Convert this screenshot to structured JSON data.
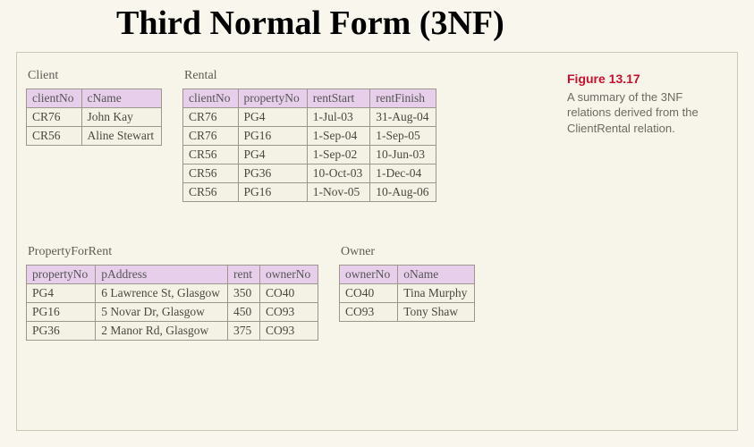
{
  "title": "Third Normal Form (3NF)",
  "caption": {
    "figure_label": "Figure 13.17",
    "text": "A summary of the 3NF relations derived from the ClientRental relation."
  },
  "tables": {
    "client": {
      "label": "Client",
      "columns": [
        "clientNo",
        "cName"
      ],
      "rows": [
        [
          "CR76",
          "John Kay"
        ],
        [
          "CR56",
          "Aline Stewart"
        ]
      ]
    },
    "rental": {
      "label": "Rental",
      "columns": [
        "clientNo",
        "propertyNo",
        "rentStart",
        "rentFinish"
      ],
      "rows": [
        [
          "CR76",
          "PG4",
          "1-Jul-03",
          "31-Aug-04"
        ],
        [
          "CR76",
          "PG16",
          "1-Sep-04",
          "1-Sep-05"
        ],
        [
          "CR56",
          "PG4",
          "1-Sep-02",
          "10-Jun-03"
        ],
        [
          "CR56",
          "PG36",
          "10-Oct-03",
          "1-Dec-04"
        ],
        [
          "CR56",
          "PG16",
          "1-Nov-05",
          "10-Aug-06"
        ]
      ]
    },
    "propertyForRent": {
      "label": "PropertyForRent",
      "columns": [
        "propertyNo",
        "pAddress",
        "rent",
        "ownerNo"
      ],
      "rows": [
        [
          "PG4",
          "6 Lawrence St, Glasgow",
          "350",
          "CO40"
        ],
        [
          "PG16",
          "5 Novar Dr, Glasgow",
          "450",
          "CO93"
        ],
        [
          "PG36",
          "2 Manor Rd, Glasgow",
          "375",
          "CO93"
        ]
      ]
    },
    "owner": {
      "label": "Owner",
      "columns": [
        "ownerNo",
        "oName"
      ],
      "rows": [
        [
          "CO40",
          "Tina Murphy"
        ],
        [
          "CO93",
          "Tony Shaw"
        ]
      ]
    }
  }
}
